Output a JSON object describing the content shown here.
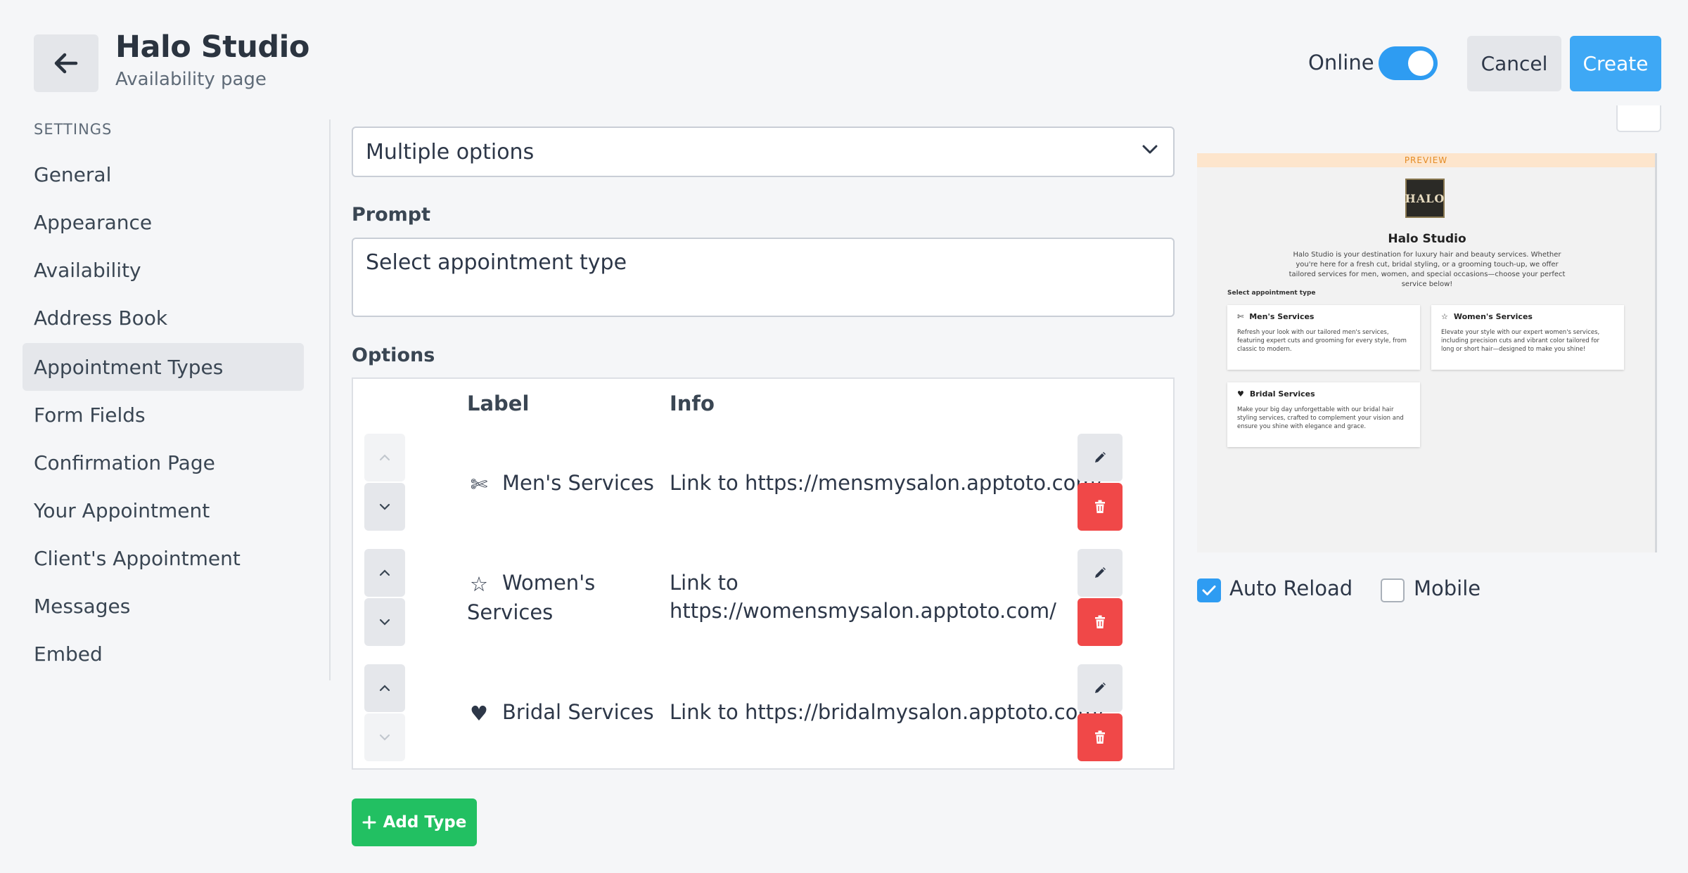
{
  "header": {
    "title": "Halo Studio",
    "subtitle": "Availability page",
    "online_label": "Online",
    "online_enabled": true,
    "cancel_label": "Cancel",
    "create_label": "Create",
    "accent_color": "#3ea8f5"
  },
  "sidebar": {
    "heading": "SETTINGS",
    "active": "Appointment Types",
    "items": [
      {
        "label": "General"
      },
      {
        "label": "Appearance"
      },
      {
        "label": "Availability"
      },
      {
        "label": "Address Book"
      },
      {
        "label": "Appointment Types"
      },
      {
        "label": "Form Fields"
      },
      {
        "label": "Confirmation Page"
      },
      {
        "label": "Your Appointment"
      },
      {
        "label": "Client's Appointment"
      },
      {
        "label": "Messages"
      },
      {
        "label": "Embed"
      }
    ]
  },
  "main": {
    "select_value": "Multiple options",
    "prompt_label": "Prompt",
    "prompt_value": "Select appointment type",
    "options_label": "Options",
    "columns": {
      "label": "Label",
      "info": "Info"
    },
    "rows": [
      {
        "icon": "scissors-icon",
        "label": "Men's Services",
        "info": "Link to https://mensmysalon.apptoto.com/"
      },
      {
        "icon": "star-outline-icon",
        "label": "Women's Services",
        "info": "Link to https://womensmysalon.apptoto.com/"
      },
      {
        "icon": "heart-icon",
        "label": "Bridal Services",
        "info": "Link to https://bridalmysalon.apptoto.com/"
      }
    ],
    "add_label": "Add Type"
  },
  "preview": {
    "banner": "PREVIEW",
    "logo_text": "HALO",
    "title": "Halo Studio",
    "description": "Halo Studio is your destination for luxury hair and beauty services. Whether you're here for a fresh cut, bridal styling, or a grooming touch-up, we offer tailored services for men, women, and special occasions—choose your perfect service below!",
    "select_label": "Select appointment type",
    "cards": [
      {
        "title": "Men's Services",
        "desc": "Refresh your look with our tailored men's services, featuring expert cuts and grooming for every style, from classic to modern."
      },
      {
        "title": "Women's Services",
        "desc": "Elevate your style with our expert women's services, including precision cuts and vibrant color tailored for long or short hair—designed to make you shine!"
      },
      {
        "title": "Bridal Services",
        "desc": "Make your big day unforgettable with our bridal hair styling services, crafted to complement your vision and ensure you shine with elegance and grace."
      }
    ],
    "auto_reload_label": "Auto Reload",
    "auto_reload_checked": true,
    "mobile_label": "Mobile",
    "mobile_checked": false
  }
}
